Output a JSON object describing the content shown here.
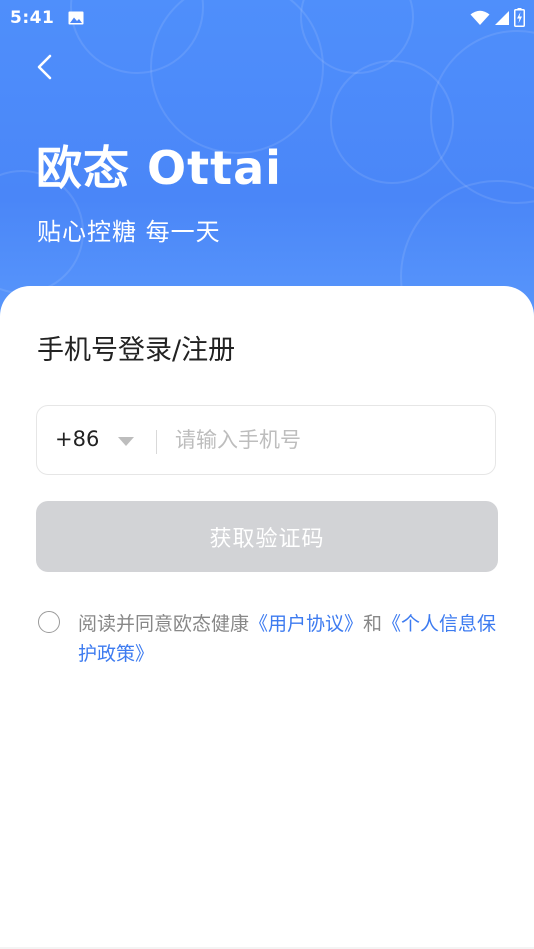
{
  "status_bar": {
    "time": "5:41"
  },
  "header": {
    "brand": "欧态 Ottai",
    "slogan": "贴心控糖 每一天"
  },
  "login": {
    "title": "手机号登录/注册",
    "country_code": "+86",
    "phone_placeholder": "请输入手机号",
    "get_code_label": "获取验证码"
  },
  "agreement": {
    "prefix": "阅读并同意欧态健康",
    "user_agreement": "《用户协议》",
    "conjunction": "和",
    "privacy_policy": "《个人信息保护政策》"
  },
  "colors": {
    "header_blue": "#4a86f8",
    "link_blue": "#3d7bf0",
    "button_disabled": "#d2d3d6"
  }
}
